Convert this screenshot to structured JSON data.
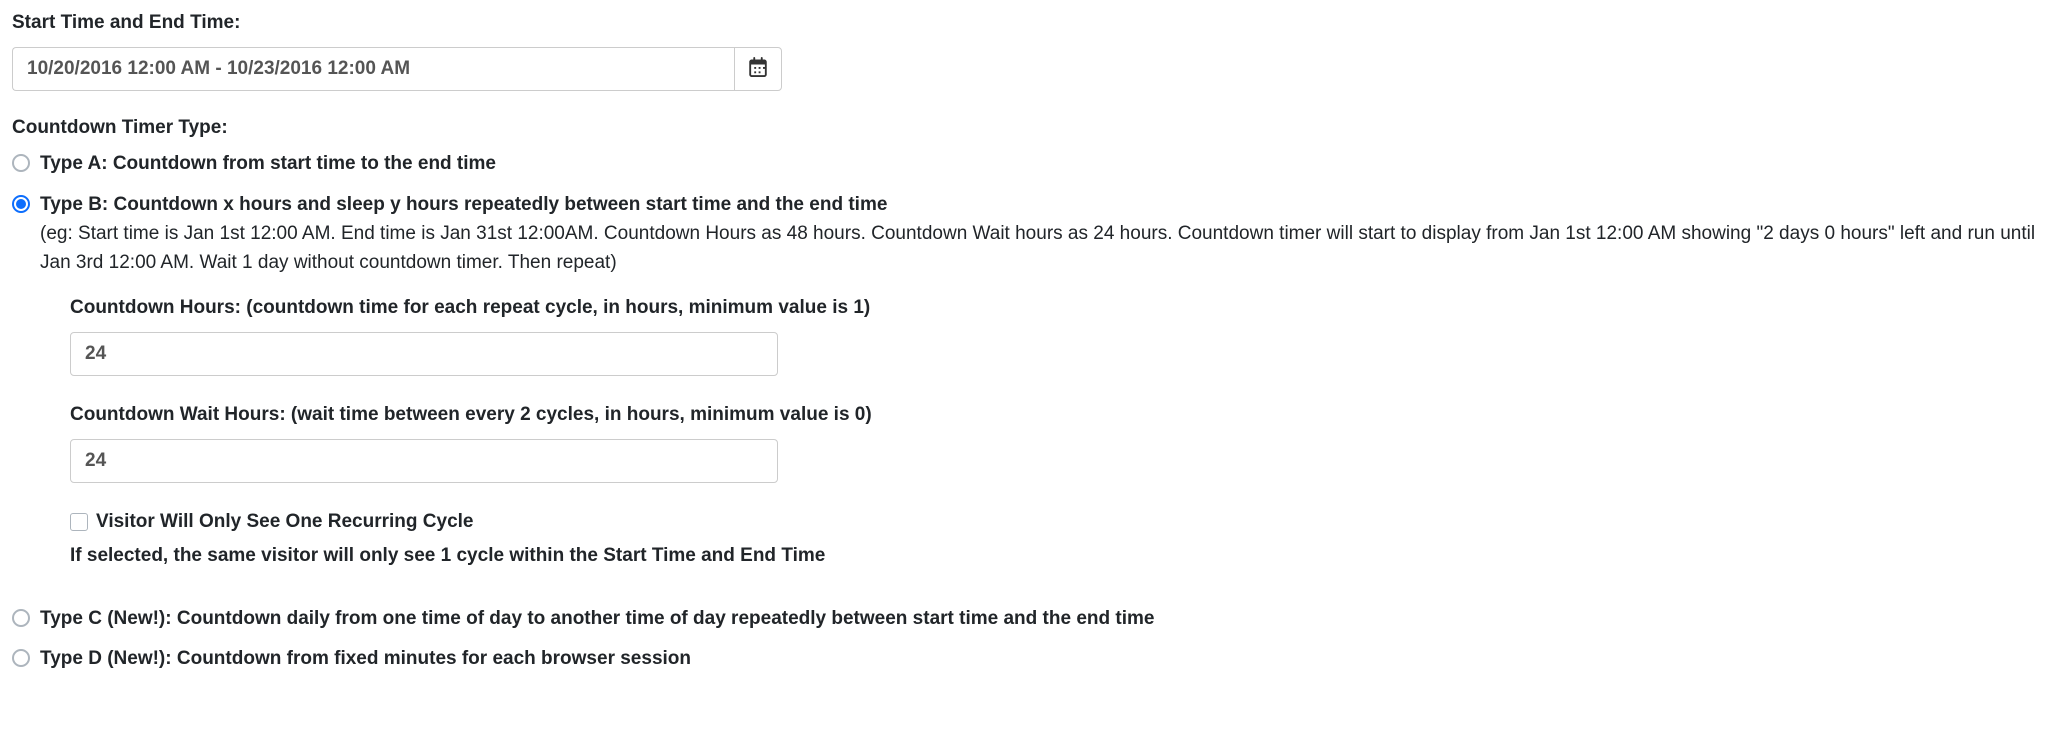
{
  "time_range": {
    "label": "Start Time and End Time:",
    "value": "10/20/2016 12:00 AM - 10/23/2016 12:00 AM"
  },
  "timer_type": {
    "label": "Countdown Timer Type:",
    "options": {
      "a": "Type A: Countdown from start time to the end time",
      "b": "Type B: Countdown x hours and sleep y hours repeatedly between start time and the end time",
      "b_hint": "(eg: Start time is Jan 1st 12:00 AM. End time is Jan 31st 12:00AM. Countdown Hours as 48 hours. Countdown Wait hours as 24 hours. Countdown timer will start to display from Jan 1st 12:00 AM showing \"2 days 0 hours\" left and run until Jan 3rd 12:00 AM. Wait 1 day without countdown timer. Then repeat)",
      "c": "Type C (New!): Countdown daily from one time of day to another time of day repeatedly between start time and the end time",
      "d": "Type D (New!): Countdown from fixed minutes for each browser session"
    }
  },
  "type_b": {
    "countdown_hours_label": "Countdown Hours: (countdown time for each repeat cycle, in hours, minimum value is 1)",
    "countdown_hours_value": "24",
    "wait_hours_label": "Countdown Wait Hours: (wait time between every 2 cycles, in hours, minimum value is 0)",
    "wait_hours_value": "24",
    "one_cycle_label": "Visitor Will Only See One Recurring Cycle",
    "one_cycle_hint": "If selected, the same visitor will only see 1 cycle within the Start Time and End Time"
  }
}
